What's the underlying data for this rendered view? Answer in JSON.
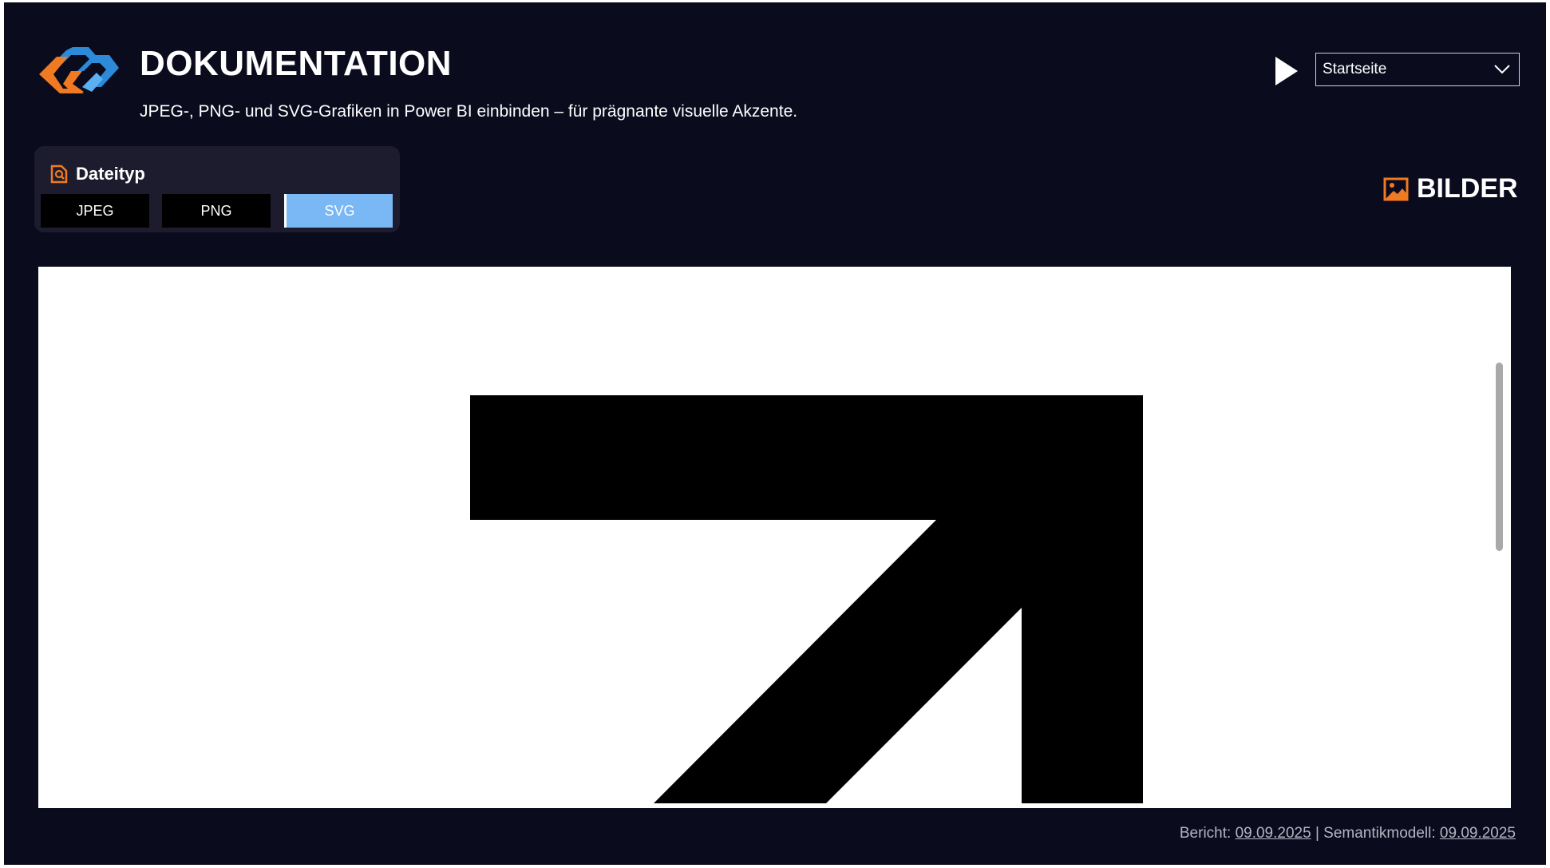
{
  "header": {
    "title": "DOKUMENTATION",
    "subtitle": "JPEG-, PNG- und SVG-Grafiken in Power BI einbinden – für prägnante visuelle Akzente.",
    "play_icon": "play-icon",
    "page_select": {
      "value": "Startseite",
      "icon": "chevron-down-icon"
    }
  },
  "colors": {
    "background": "#0b0b1e",
    "accent_orange": "#f07a22",
    "accent_blue": "#7ab8f5",
    "card": "#1c1c2e"
  },
  "filter": {
    "label": "Dateityp",
    "icon": "file-search-icon",
    "options": [
      {
        "label": "JPEG",
        "selected": false
      },
      {
        "label": "PNG",
        "selected": false
      },
      {
        "label": "SVG",
        "selected": true
      }
    ]
  },
  "section": {
    "label": "BILDER",
    "icon": "image-icon"
  },
  "preview": {
    "content": "arrow-up-right-icon"
  },
  "footer": {
    "report_label": "Bericht:",
    "report_date": "09.09.2025",
    "separator": "|",
    "model_label": "Semantikmodell:",
    "model_date": "09.09.2025"
  }
}
